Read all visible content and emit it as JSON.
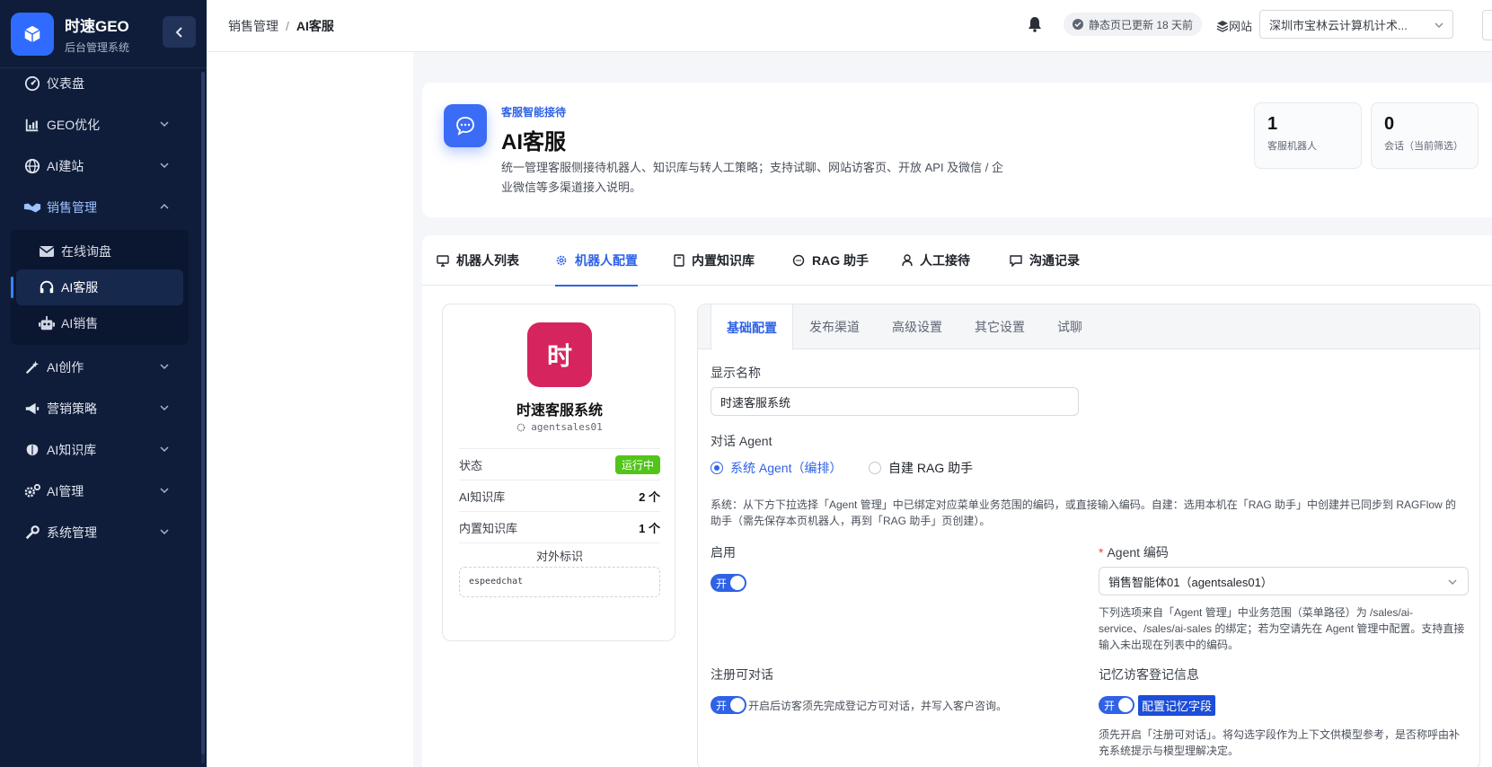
{
  "brand": {
    "title": "时速GEO",
    "subtitle": "后台管理系统"
  },
  "sidebar": {
    "items": [
      {
        "label": "仪表盘",
        "icon": "dashboard-icon"
      },
      {
        "label": "GEO优化",
        "icon": "chart-icon"
      },
      {
        "label": "AI建站",
        "icon": "globe-icon"
      },
      {
        "label": "销售管理",
        "icon": "handshake-icon",
        "open": true
      },
      {
        "label": "AI创作",
        "icon": "magic-wand-icon"
      },
      {
        "label": "营销策略",
        "icon": "megaphone-icon"
      },
      {
        "label": "AI知识库",
        "icon": "brain-icon"
      },
      {
        "label": "AI管理",
        "icon": "gears-icon"
      },
      {
        "label": "系统管理",
        "icon": "wrench-icon"
      }
    ],
    "sales_sub": [
      {
        "label": "在线询盘",
        "icon": "envelope-icon"
      },
      {
        "label": "AI客服",
        "icon": "headset-icon",
        "active": true
      },
      {
        "label": "AI销售",
        "icon": "robot-icon"
      }
    ]
  },
  "header": {
    "breadcrumb": {
      "parent": "销售管理",
      "separator": "/",
      "current": "AI客服"
    },
    "update_text": "静态页已更新 18 天前",
    "site_label": "网站",
    "site_value": "深圳市宝林云计算机计术..."
  },
  "hero": {
    "eyebrow": "客服智能接待",
    "title": "AI客服",
    "description": "统一管理客服侧接待机器人、知识库与转人工策略；支持试聊、网站访客页、开放 API 及微信 / 企业微信等多渠道接入说明。",
    "stats": [
      {
        "value": "1",
        "label": "客服机器人"
      },
      {
        "value": "0",
        "label": "会话（当前筛选）"
      }
    ]
  },
  "tabs": [
    {
      "label": "机器人列表",
      "icon": "monitor-icon"
    },
    {
      "label": "机器人配置",
      "icon": "gear-icon",
      "active": true
    },
    {
      "label": "内置知识库",
      "icon": "book-icon"
    },
    {
      "label": "RAG 助手",
      "icon": "chat-icon"
    },
    {
      "label": "人工接待",
      "icon": "user-icon"
    },
    {
      "label": "沟通记录",
      "icon": "message-icon"
    }
  ],
  "bot": {
    "avatar_char": "时",
    "name": "时速客服系统",
    "code": "agentsales01",
    "rows": [
      {
        "label": "状态",
        "value": "运行中"
      },
      {
        "label": "AI知识库",
        "value": "2 个"
      },
      {
        "label": "内置知识库",
        "value": "1 个"
      }
    ],
    "ext_label": "对外标识",
    "ext_value": "espeedchat"
  },
  "config": {
    "tabs": [
      "基础配置",
      "发布渠道",
      "高级设置",
      "其它设置",
      "试聊"
    ],
    "display_name_label": "显示名称",
    "display_name_value": "时速客服系统",
    "agent_label": "对话 Agent",
    "radio_system": "系统 Agent（编排）",
    "radio_custom": "自建 RAG 助手",
    "agent_hint": "系统：从下方下拉选择「Agent 管理」中已绑定对应菜单业务范围的编码，或直接输入编码。自建：选用本机在「RAG 助手」中创建并已同步到 RAGFlow 的助手（需先保存本页机器人，再到「RAG 助手」页创建）。",
    "enable_label": "启用",
    "toggle_on": "开",
    "agent_code_label": "Agent 编码",
    "agent_code_value": "销售智能体01（agentsales01）",
    "agent_code_hint": "下列选项来自「Agent 管理」中业务范围（菜单路径）为 /sales/ai-service、/sales/ai-sales 的绑定；若为空请先在 Agent 管理中配置。支持直接输入未出现在列表中的编码。",
    "register_label": "注册可对话",
    "register_hint": "开启后访客须先完成登记方可对话，并写入客户咨询。",
    "memory_label": "记忆访客登记信息",
    "memory_button": "配置记忆字段",
    "memory_hint": "须先开启「注册可对话」。将勾选字段作为上下文供模型参考，是否称呼由补充系统提示与模型理解决定。"
  },
  "colors": {
    "accent": "#2f62e6",
    "sidebar": "#0f1d3a",
    "success": "#52c41a",
    "avatar": "#d6245e"
  }
}
